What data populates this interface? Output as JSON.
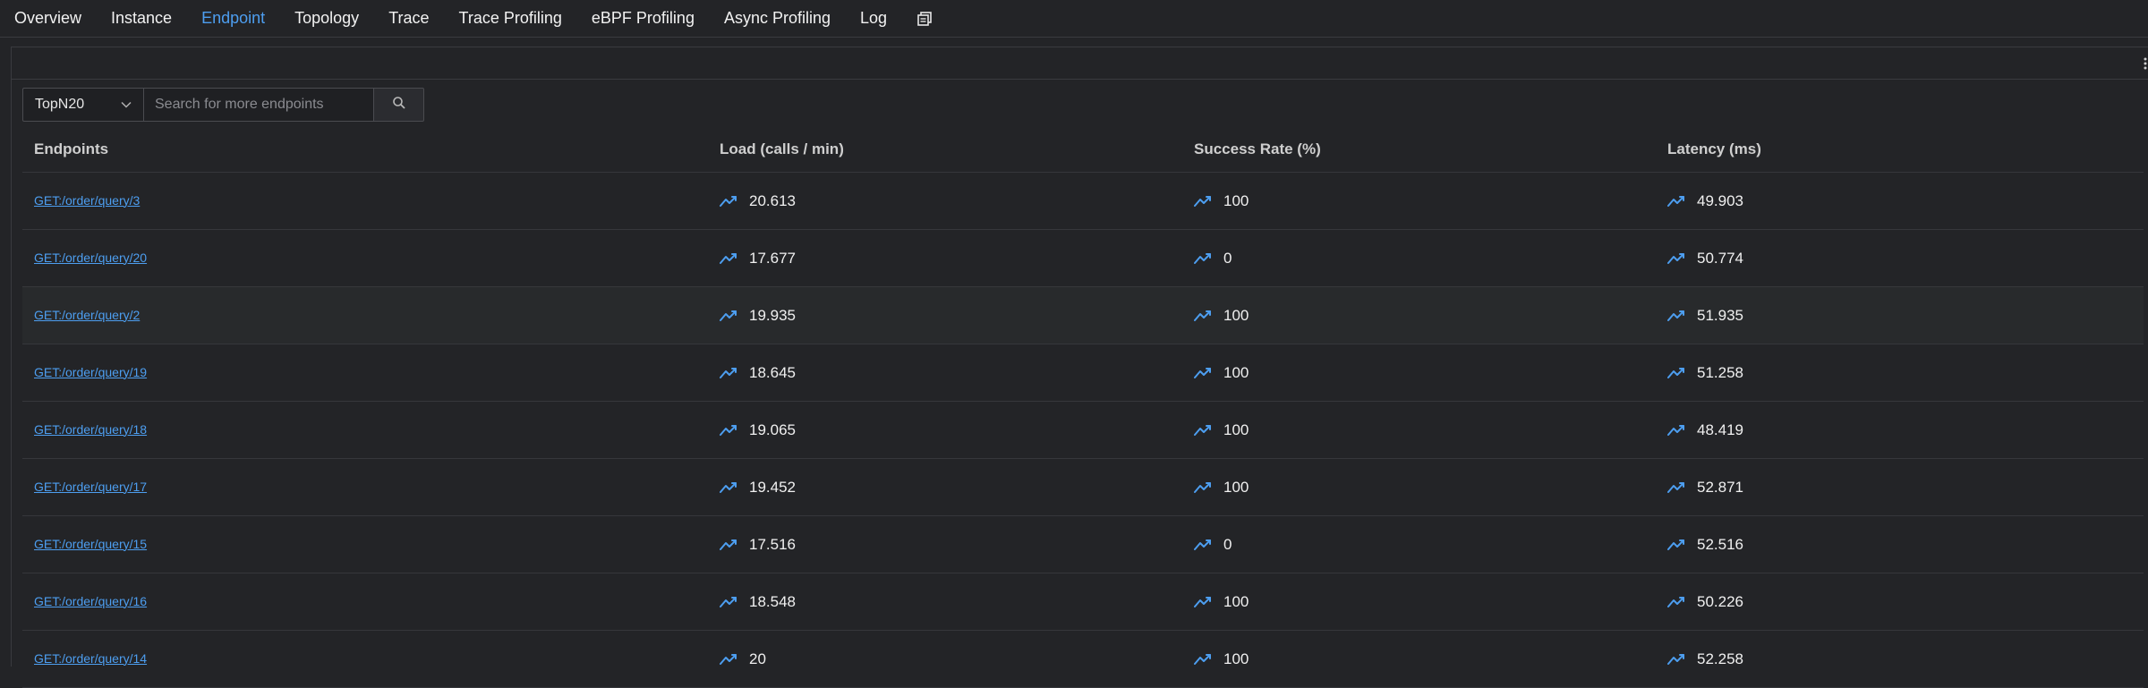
{
  "tabs": [
    {
      "label": "Overview"
    },
    {
      "label": "Instance"
    },
    {
      "label": "Endpoint",
      "active": true
    },
    {
      "label": "Topology"
    },
    {
      "label": "Trace"
    },
    {
      "label": "Trace Profiling"
    },
    {
      "label": "eBPF Profiling"
    },
    {
      "label": "Async Profiling"
    },
    {
      "label": "Log"
    }
  ],
  "toolbar": {
    "topn_value": "TopN20",
    "search_placeholder": "Search for more endpoints"
  },
  "table": {
    "headers": {
      "endpoints": "Endpoints",
      "load": "Load (calls / min)",
      "success": "Success Rate (%)",
      "latency": "Latency (ms)"
    },
    "rows": [
      {
        "endpoint": "GET:/order/query/3",
        "load": "20.613",
        "success": "100",
        "latency": "49.903"
      },
      {
        "endpoint": "GET:/order/query/20",
        "load": "17.677",
        "success": "0",
        "latency": "50.774"
      },
      {
        "endpoint": "GET:/order/query/2",
        "load": "19.935",
        "success": "100",
        "latency": "51.935"
      },
      {
        "endpoint": "GET:/order/query/19",
        "load": "18.645",
        "success": "100",
        "latency": "51.258"
      },
      {
        "endpoint": "GET:/order/query/18",
        "load": "19.065",
        "success": "100",
        "latency": "48.419"
      },
      {
        "endpoint": "GET:/order/query/17",
        "load": "19.452",
        "success": "100",
        "latency": "52.871"
      },
      {
        "endpoint": "GET:/order/query/15",
        "load": "17.516",
        "success": "0",
        "latency": "52.516"
      },
      {
        "endpoint": "GET:/order/query/16",
        "load": "18.548",
        "success": "100",
        "latency": "50.226"
      },
      {
        "endpoint": "GET:/order/query/14",
        "load": "20",
        "success": "100",
        "latency": "52.258"
      }
    ]
  },
  "colors": {
    "accent": "#4d9ef0",
    "background": "#232427"
  }
}
